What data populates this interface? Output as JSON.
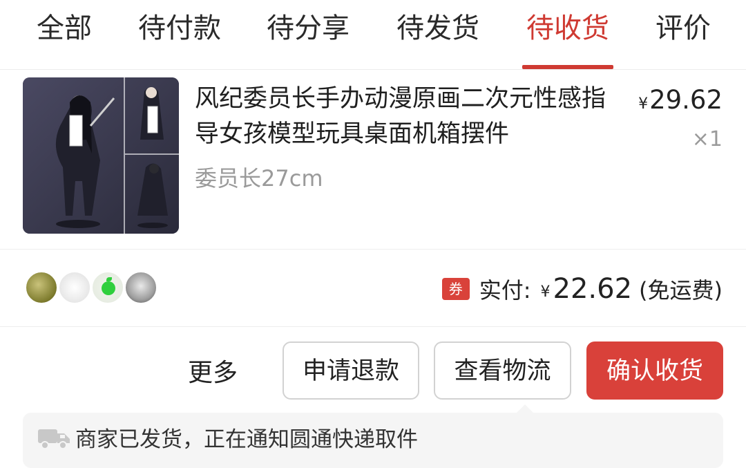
{
  "tabs": [
    {
      "label": "全部",
      "active": false
    },
    {
      "label": "待付款",
      "active": false
    },
    {
      "label": "待分享",
      "active": false
    },
    {
      "label": "待发货",
      "active": false
    },
    {
      "label": "待收货",
      "active": true
    },
    {
      "label": "评价",
      "active": false
    }
  ],
  "order": {
    "product_title": "风纪委员长手办动漫原画二次元性感指导女孩模型玩具桌面机箱摆件",
    "spec": "委员长27cm",
    "price_symbol": "¥",
    "price": "29.62",
    "quantity": "×1"
  },
  "summary": {
    "coupon_badge": "券",
    "paid_label": "实付:",
    "paid_symbol": "¥",
    "paid_amount": "22.62",
    "shipping_note": "(免运费)"
  },
  "actions": {
    "more": "更多",
    "refund": "申请退款",
    "logistics": "查看物流",
    "confirm": "确认收货"
  },
  "notice": {
    "text": "商家已发货，正在通知圆通快递取件"
  },
  "colors": {
    "accent": "#cf3a32",
    "primary_button": "#d9413a",
    "notice_bg": "#f5f5f5"
  },
  "icons": {
    "coupon": "coupon-icon",
    "truck": "truck-icon"
  }
}
